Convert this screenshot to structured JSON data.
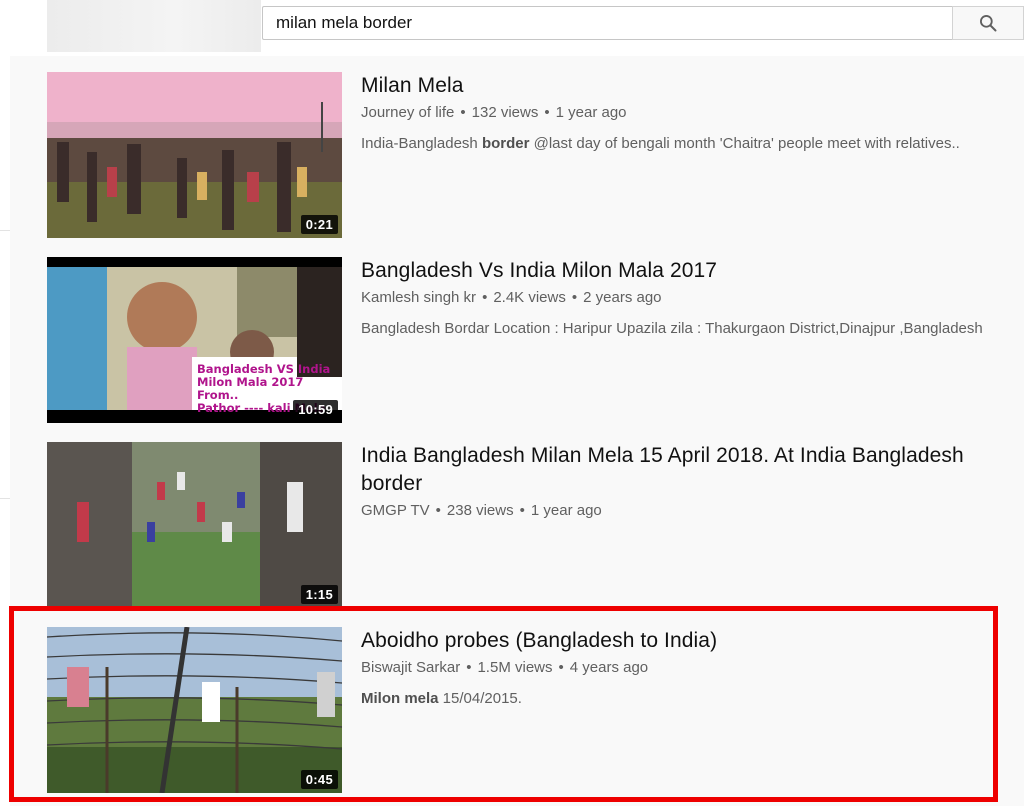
{
  "search": {
    "query": "milan mela border",
    "icon": "search-icon"
  },
  "results": [
    {
      "title": "Milan Mela",
      "channel": "Journey of life",
      "views": "132 views",
      "age": "1 year ago",
      "desc_before": "India-Bangladesh ",
      "desc_bold": "border",
      "desc_after": " @last day of bengali month 'Chaitra' people meet with relatives..",
      "duration": "0:21"
    },
    {
      "title": "Bangladesh Vs India Milon Mala 2017",
      "channel": "Kamlesh singh kr",
      "views": "2.4K views",
      "age": "2 years ago",
      "desc_before": "Bangladesh Bordar Location : Haripur Upazila zila : Thakurgaon District,Dinajpur ,Bangladesh",
      "desc_bold": "",
      "desc_after": "",
      "duration": "10:59",
      "thumb_caption": [
        "Bangladesh VS India",
        "Milon Mala 2017 From..",
        "Pathor ---- kali Mela"
      ]
    },
    {
      "title": "India Bangladesh Milan Mela 15 April 2018. At India Bangladesh border",
      "channel": "GMGP TV",
      "views": "238 views",
      "age": "1 year ago",
      "desc_before": "",
      "desc_bold": "",
      "desc_after": "",
      "duration": "1:15"
    },
    {
      "title": "Aboidho probes (Bangladesh to India)",
      "channel": "Biswajit Sarkar",
      "views": "1.5M views",
      "age": "4 years ago",
      "desc_before": "",
      "desc_bold": "Milon mela",
      "desc_after": " 15/04/2015.",
      "duration": "0:45"
    }
  ],
  "colors": {
    "highlight": "#ee0000",
    "meta_text": "#606060",
    "background": "#f9f9f9"
  }
}
